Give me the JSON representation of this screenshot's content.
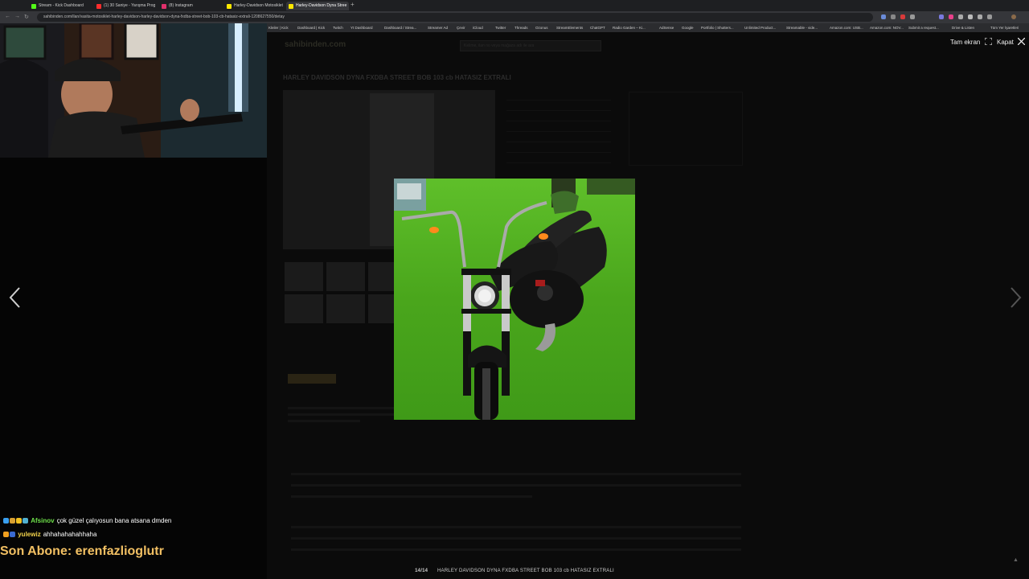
{
  "browser": {
    "tabs": [
      {
        "title": "Stream - Kick Dashboard",
        "fav": "#53fc18"
      },
      {
        "title": "(1) 30 Saniye - Yarışma Prog",
        "fav": "#ff2d2d"
      },
      {
        "title": "(8) Instagram",
        "fav": "#e1306c"
      },
      {
        "title": "Harley-Davidson Motosiklet",
        "fav": "#ffe800"
      },
      {
        "title": "Harley-Davidson Dyna Stree",
        "fav": "#ffe800"
      }
    ],
    "new_tab": "+",
    "url": "sahibinden.com/ilan/vasita-motosiklet-harley-davidson-harley-davidson-dyna-fxdba-street-bob-103-cb-hatasiz-extrali-1208627550/detay",
    "bookmarks": [
      "Kleiler | Kick",
      "Dashboard | Kick",
      "Twitch",
      "Yt Dashboard",
      "Dashboard / Strea...",
      "Streamer Ad",
      "Çevir",
      "iCloud",
      "Twitter",
      "Threads",
      "Ozonus",
      "StreamElements",
      "ChatGPT",
      "Radio Garden – Ki...",
      "AdSense",
      "Google",
      "Portfolio | Shutters...",
      "Unlimited Product...",
      "Streamable - vide...",
      "Amazon.com: USB...",
      "Amazon.com: NOV...",
      "Submit a request...",
      "Drive & Listen",
      "Tüm Yer İşaretleri"
    ]
  },
  "background_page": {
    "logo": "sahibinden.com",
    "search_placeholder": "Kelime, ilan no veya mağaza adı ile ara",
    "title": "HARLEY DAVIDSON DYNA FXDBA STREET BOB 103 cb HATASIZ EXTRALI"
  },
  "lightbox": {
    "fullscreen_label": "Tam ekran",
    "close_label": "Kapat",
    "counter": "14/14",
    "caption": "HARLEY DAVIDSON DYNA FXDBA STREET BOB 103 cb HATASIZ EXTRALI"
  },
  "chat": {
    "messages": [
      {
        "user": "Afsinov",
        "user_color": "#6ee04a",
        "text": "çok güzel çalıyosun bana atsana dmden"
      },
      {
        "user": "yulewiz",
        "user_color": "#f2d24b",
        "text": "ahhahahahahhaha"
      }
    ],
    "sub_alert": "Son Abone: erenfazlioglutr"
  }
}
